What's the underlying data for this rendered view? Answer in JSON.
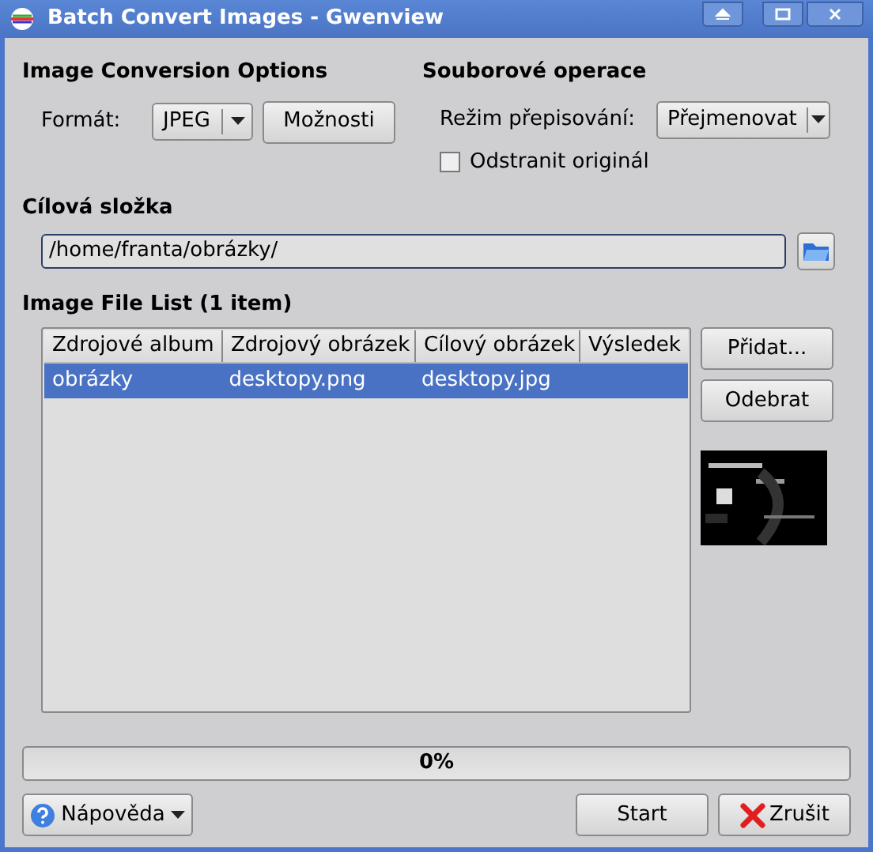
{
  "window": {
    "title": "Batch Convert Images - Gwenview"
  },
  "conversion": {
    "heading": "Image Conversion Options",
    "format_label": "Formát:",
    "format_value": "JPEG",
    "options_button": "Možnosti"
  },
  "file_ops": {
    "heading": "Souborové operace",
    "overwrite_label": "Režim přepisování:",
    "overwrite_value": "Přejmenovat",
    "delete_original": {
      "label": "Odstranit originál",
      "checked": false
    }
  },
  "destination": {
    "heading": "Cílová složka",
    "value": "/home/franta/obrázky/"
  },
  "file_list": {
    "heading": "Image File List (1 item)",
    "columns": [
      "Zdrojové album",
      "Zdrojový obrázek",
      "Cílový obrázek",
      "Výsledek"
    ],
    "rows": [
      {
        "cells": [
          "obrázky",
          "desktopy.png",
          "desktopy.jpg",
          ""
        ],
        "selected": true
      }
    ],
    "buttons": [
      "Přidat...",
      "Odebrat"
    ]
  },
  "progress": {
    "level": 0,
    "label": "0%"
  },
  "buttons": {
    "help": "Nápověda",
    "start": "Start",
    "cancel": "Zrušit"
  }
}
